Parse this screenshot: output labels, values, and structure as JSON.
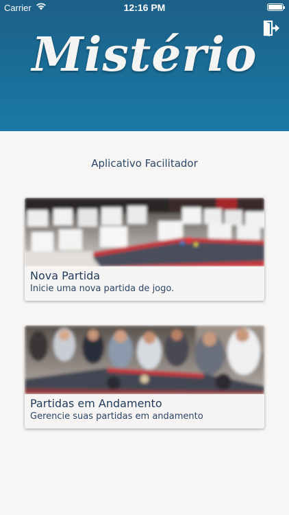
{
  "status_bar": {
    "carrier": "Carrier",
    "time": "12:16 PM"
  },
  "header": {
    "logo_text": "Mistério",
    "exit_icon": "exit-door-icon"
  },
  "main": {
    "subtitle": "Aplicativo Facilitador",
    "cards": [
      {
        "title": "Nova Partida",
        "description": "Inicie uma nova partida de jogo.",
        "image": "blurred-game-table-room"
      },
      {
        "title": "Partidas em Andamento",
        "description": "Gerencie suas partidas em andamento",
        "image": "blurred-people-around-table"
      }
    ]
  },
  "colors": {
    "header_top": "#1d5f86",
    "header_bottom": "#1b7aa6",
    "background": "#f7f6f4",
    "text": "#1f3a5a"
  }
}
